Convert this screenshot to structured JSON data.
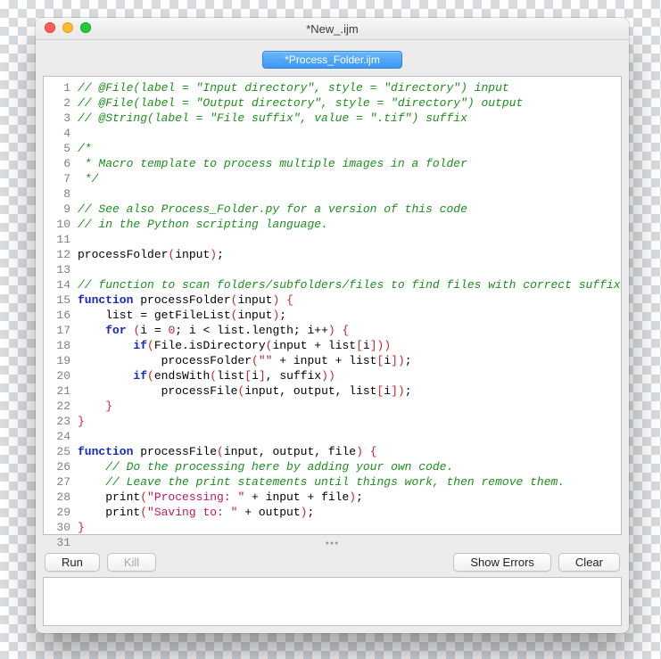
{
  "window": {
    "title": "*New_.ijm",
    "tab_label": "*Process_Folder.ijm"
  },
  "buttons": {
    "run": "Run",
    "kill": "Kill",
    "show_errors": "Show Errors",
    "clear": "Clear"
  },
  "editor": {
    "line_count": 31,
    "current_line": 31,
    "lines": [
      {
        "num": 1,
        "tokens": [
          {
            "t": "// @File(label = \"Input directory\", style = \"directory\") input",
            "c": "c-comment"
          }
        ]
      },
      {
        "num": 2,
        "tokens": [
          {
            "t": "// @File(label = \"Output directory\", style = \"directory\") output",
            "c": "c-comment"
          }
        ]
      },
      {
        "num": 3,
        "tokens": [
          {
            "t": "// @String(label = \"File suffix\", value = \".tif\") suffix",
            "c": "c-comment"
          }
        ]
      },
      {
        "num": 4,
        "tokens": []
      },
      {
        "num": 5,
        "tokens": [
          {
            "t": "/*",
            "c": "c-comment"
          }
        ]
      },
      {
        "num": 6,
        "tokens": [
          {
            "t": " * Macro template to process multiple images in a folder",
            "c": "c-comment"
          }
        ]
      },
      {
        "num": 7,
        "tokens": [
          {
            "t": " */",
            "c": "c-comment"
          }
        ]
      },
      {
        "num": 8,
        "tokens": []
      },
      {
        "num": 9,
        "tokens": [
          {
            "t": "// See also Process_Folder.py for a version of this code",
            "c": "c-comment"
          }
        ]
      },
      {
        "num": 10,
        "tokens": [
          {
            "t": "// in the Python scripting language.",
            "c": "c-comment"
          }
        ]
      },
      {
        "num": 11,
        "tokens": []
      },
      {
        "num": 12,
        "tokens": [
          {
            "t": "processFolder",
            "c": "c-func"
          },
          {
            "t": "(",
            "c": "c-red"
          },
          {
            "t": "input",
            "c": ""
          },
          {
            "t": ")",
            "c": "c-red"
          },
          {
            "t": ";",
            "c": ""
          }
        ]
      },
      {
        "num": 13,
        "tokens": []
      },
      {
        "num": 14,
        "tokens": [
          {
            "t": "// function to scan folders/subfolders/files to find files with correct suffix",
            "c": "c-comment"
          }
        ]
      },
      {
        "num": 15,
        "tokens": [
          {
            "t": "function",
            "c": "c-key"
          },
          {
            "t": " processFolder",
            "c": ""
          },
          {
            "t": "(",
            "c": "c-red"
          },
          {
            "t": "input",
            "c": ""
          },
          {
            "t": ")",
            "c": "c-red"
          },
          {
            "t": " ",
            "c": ""
          },
          {
            "t": "{",
            "c": "c-red"
          }
        ]
      },
      {
        "num": 16,
        "tokens": [
          {
            "t": "    list = getFileList",
            "c": ""
          },
          {
            "t": "(",
            "c": "c-red"
          },
          {
            "t": "input",
            "c": ""
          },
          {
            "t": ")",
            "c": "c-red"
          },
          {
            "t": ";",
            "c": ""
          }
        ]
      },
      {
        "num": 17,
        "tokens": [
          {
            "t": "    ",
            "c": ""
          },
          {
            "t": "for",
            "c": "c-key"
          },
          {
            "t": " ",
            "c": ""
          },
          {
            "t": "(",
            "c": "c-red"
          },
          {
            "t": "i = ",
            "c": ""
          },
          {
            "t": "0",
            "c": "c-num"
          },
          {
            "t": "; i < list.length; i++",
            "c": ""
          },
          {
            "t": ")",
            "c": "c-red"
          },
          {
            "t": " ",
            "c": ""
          },
          {
            "t": "{",
            "c": "c-red"
          }
        ]
      },
      {
        "num": 18,
        "tokens": [
          {
            "t": "        ",
            "c": ""
          },
          {
            "t": "if",
            "c": "c-key"
          },
          {
            "t": "(",
            "c": "c-red"
          },
          {
            "t": "File.isDirectory",
            "c": ""
          },
          {
            "t": "(",
            "c": "c-red"
          },
          {
            "t": "input + list",
            "c": ""
          },
          {
            "t": "[",
            "c": "c-red"
          },
          {
            "t": "i",
            "c": ""
          },
          {
            "t": "]",
            "c": "c-red"
          },
          {
            "t": ")",
            "c": "c-red"
          },
          {
            "t": ")",
            "c": "c-red"
          }
        ]
      },
      {
        "num": 19,
        "tokens": [
          {
            "t": "            processFolder",
            "c": ""
          },
          {
            "t": "(",
            "c": "c-red"
          },
          {
            "t": "\"\"",
            "c": "c-str"
          },
          {
            "t": " + input + list",
            "c": ""
          },
          {
            "t": "[",
            "c": "c-red"
          },
          {
            "t": "i",
            "c": ""
          },
          {
            "t": "]",
            "c": "c-red"
          },
          {
            "t": ")",
            "c": "c-red"
          },
          {
            "t": ";",
            "c": ""
          }
        ]
      },
      {
        "num": 20,
        "tokens": [
          {
            "t": "        ",
            "c": ""
          },
          {
            "t": "if",
            "c": "c-key"
          },
          {
            "t": "(",
            "c": "c-red"
          },
          {
            "t": "endsWith",
            "c": ""
          },
          {
            "t": "(",
            "c": "c-red"
          },
          {
            "t": "list",
            "c": ""
          },
          {
            "t": "[",
            "c": "c-red"
          },
          {
            "t": "i",
            "c": ""
          },
          {
            "t": "]",
            "c": "c-red"
          },
          {
            "t": ", suffix",
            "c": ""
          },
          {
            "t": ")",
            "c": "c-red"
          },
          {
            "t": ")",
            "c": "c-red"
          }
        ]
      },
      {
        "num": 21,
        "tokens": [
          {
            "t": "            processFile",
            "c": ""
          },
          {
            "t": "(",
            "c": "c-red"
          },
          {
            "t": "input, output, list",
            "c": ""
          },
          {
            "t": "[",
            "c": "c-red"
          },
          {
            "t": "i",
            "c": ""
          },
          {
            "t": "]",
            "c": "c-red"
          },
          {
            "t": ")",
            "c": "c-red"
          },
          {
            "t": ";",
            "c": ""
          }
        ]
      },
      {
        "num": 22,
        "tokens": [
          {
            "t": "    ",
            "c": ""
          },
          {
            "t": "}",
            "c": "c-red"
          }
        ]
      },
      {
        "num": 23,
        "tokens": [
          {
            "t": "}",
            "c": "c-red"
          }
        ]
      },
      {
        "num": 24,
        "tokens": []
      },
      {
        "num": 25,
        "tokens": [
          {
            "t": "function",
            "c": "c-key"
          },
          {
            "t": " processFile",
            "c": ""
          },
          {
            "t": "(",
            "c": "c-red"
          },
          {
            "t": "input, output, file",
            "c": ""
          },
          {
            "t": ")",
            "c": "c-red"
          },
          {
            "t": " ",
            "c": ""
          },
          {
            "t": "{",
            "c": "c-red"
          }
        ]
      },
      {
        "num": 26,
        "tokens": [
          {
            "t": "    ",
            "c": ""
          },
          {
            "t": "// Do the processing here by adding your own code.",
            "c": "c-comment"
          }
        ]
      },
      {
        "num": 27,
        "tokens": [
          {
            "t": "    ",
            "c": ""
          },
          {
            "t": "// Leave the print statements until things work, then remove them.",
            "c": "c-comment"
          }
        ]
      },
      {
        "num": 28,
        "tokens": [
          {
            "t": "    print",
            "c": ""
          },
          {
            "t": "(",
            "c": "c-red"
          },
          {
            "t": "\"Processing: \"",
            "c": "c-str"
          },
          {
            "t": " + input + file",
            "c": ""
          },
          {
            "t": ")",
            "c": "c-red"
          },
          {
            "t": ";",
            "c": ""
          }
        ]
      },
      {
        "num": 29,
        "tokens": [
          {
            "t": "    print",
            "c": ""
          },
          {
            "t": "(",
            "c": "c-red"
          },
          {
            "t": "\"Saving to: \"",
            "c": "c-str"
          },
          {
            "t": " + output",
            "c": ""
          },
          {
            "t": ")",
            "c": "c-red"
          },
          {
            "t": ";",
            "c": ""
          }
        ]
      },
      {
        "num": 30,
        "tokens": [
          {
            "t": "}",
            "c": "c-red"
          }
        ]
      },
      {
        "num": 31,
        "tokens": []
      }
    ]
  }
}
